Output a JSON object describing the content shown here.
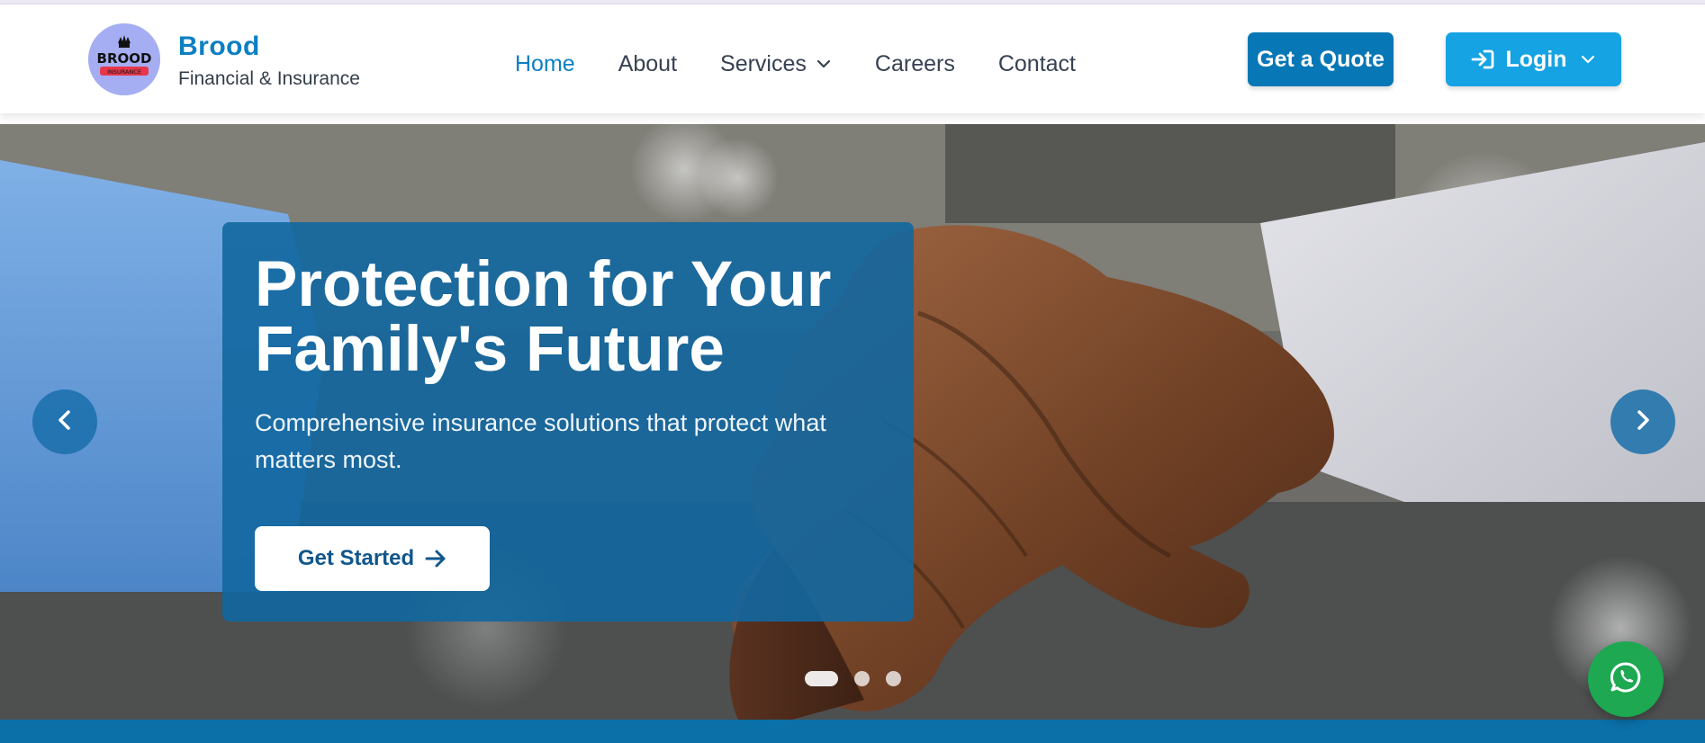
{
  "brand": {
    "name": "Brood",
    "subtitle": "Financial & Insurance",
    "logo_text": "BROOD",
    "logo_badge": "INSURANCE",
    "logo_bg": "#a5aef2",
    "accent": "#0c7fc4"
  },
  "nav": {
    "items": [
      {
        "label": "Home",
        "active": true
      },
      {
        "label": "About"
      },
      {
        "label": "Services",
        "has_dropdown": true
      },
      {
        "label": "Careers"
      },
      {
        "label": "Contact"
      }
    ]
  },
  "actions": {
    "quote_label": "Get a Quote",
    "login_label": "Login",
    "quote_color": "#0877b5",
    "login_color": "#15a3e3"
  },
  "hero": {
    "title": "Protection for Your Family's Future",
    "subtitle": "Comprehensive insurance solutions that protect what matters most.",
    "cta_label": "Get Started",
    "card_color": "#12679f",
    "background": "handshake-photo",
    "slides": {
      "count": 3,
      "active": 1
    }
  },
  "icons": {
    "prev": "chevron-left-icon",
    "next": "chevron-right-icon",
    "login": "sign-in-icon",
    "cta": "arrow-right-icon",
    "whatsapp": "whatsapp-icon"
  },
  "whatsapp_color": "#1da851"
}
